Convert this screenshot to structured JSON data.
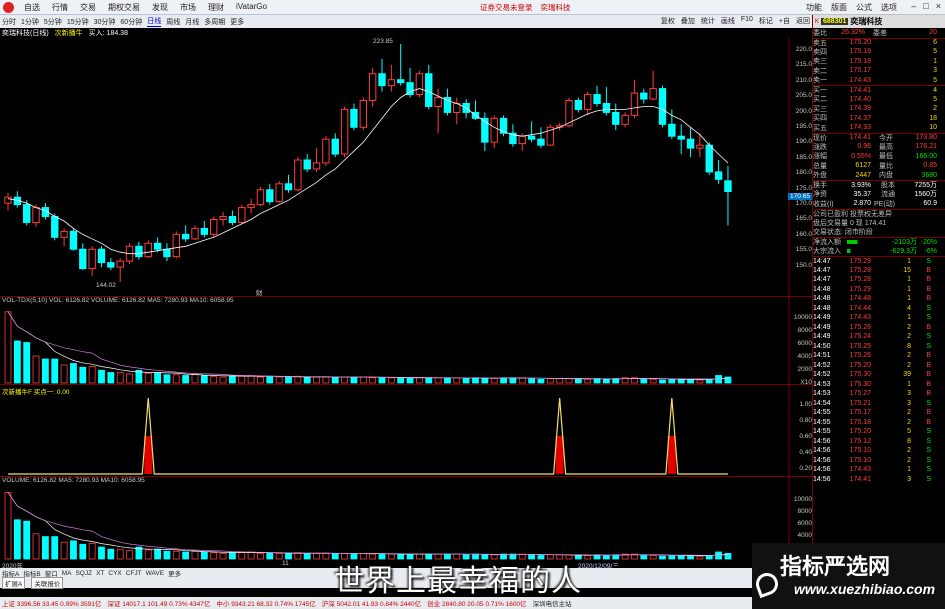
{
  "titlebar": {
    "menu": [
      "自选",
      "行情",
      "交易",
      "期权交易",
      "发现",
      "市场",
      "理财",
      "iVatarGo"
    ],
    "center": [
      "证券交易未登录",
      "奕瑞科技"
    ],
    "right": [
      "功能",
      "版面",
      "公式",
      "选项"
    ],
    "winbtns": [
      "–",
      "□",
      "×"
    ]
  },
  "periodbar": {
    "items": [
      "分时",
      "1分钟",
      "5分钟",
      "15分钟",
      "30分钟",
      "60分钟",
      "日线",
      "周线",
      "月线",
      "多周期",
      "更多"
    ],
    "selected": "日线",
    "tools": [
      "复权",
      "叠加",
      "统计",
      "画线",
      "F10",
      "标记",
      "+自",
      "返回"
    ]
  },
  "infoline": {
    "title": "奕瑞科技(日线)",
    "indicator": "次新播牛",
    "buy": "买入: 184.38"
  },
  "chart": {
    "price_axis": [
      "220.0",
      "215.0",
      "210.0",
      "205.0",
      "200.0",
      "195.0",
      "190.0",
      "185.0",
      "180.0",
      "175.0",
      "170.0",
      "165.0",
      "160.0",
      "155.0",
      "150.0"
    ],
    "current_price_tag": "170.65",
    "high_label": "223.85",
    "low_label": "144.02",
    "cai_label": "财",
    "vol_label": "VOL-TDX(5,10)  VOL: 6126.82  VOLUME: 6126.82  MA5: 7280.93  MA10: 6058.95",
    "vol_axis": [
      "10000",
      "8000",
      "6000",
      "4000",
      "2000",
      "X10"
    ],
    "ind_label": "次新播牛F  买点一: 0.00",
    "ind_axis": [
      "1.00",
      "0.80",
      "0.60",
      "0.40",
      "0.20"
    ],
    "vol2_label": "VOLUME: 6126.82  MA5: 7280.93  MA10: 6058.95",
    "vol2_axis": [
      "10000",
      "8000",
      "6000",
      "4000",
      "2000"
    ],
    "date_labels": [
      "2020年",
      "11",
      "2020/12/09/三"
    ]
  },
  "panel": {
    "code": "688301",
    "name": "奕瑞科技",
    "weibi": {
      "label": "委比",
      "val": "26.32%",
      "label2": "委差",
      "val2": "20"
    },
    "asks": [
      {
        "name": "卖五",
        "price": "175.20",
        "vol": "6"
      },
      {
        "name": "卖四",
        "price": "175.19",
        "vol": "5"
      },
      {
        "name": "卖三",
        "price": "175.18",
        "vol": "1"
      },
      {
        "name": "卖二",
        "price": "175.17",
        "vol": "3"
      },
      {
        "name": "卖一",
        "price": "174.43",
        "vol": "5"
      }
    ],
    "bids": [
      {
        "name": "买一",
        "price": "174.41",
        "vol": "4"
      },
      {
        "name": "买二",
        "price": "174.40",
        "vol": "5"
      },
      {
        "name": "买三",
        "price": "174.39",
        "vol": "2"
      },
      {
        "name": "买四",
        "price": "174.37",
        "vol": "18"
      },
      {
        "name": "买五",
        "price": "174.33",
        "vol": "10"
      }
    ],
    "stats": [
      {
        "l1": "现价",
        "v1": "174.41",
        "l2": "今开",
        "v2": "173.80"
      },
      {
        "l1": "涨跌",
        "v1": "0.96",
        "l2": "最高",
        "v2": "176.21"
      },
      {
        "l1": "涨幅",
        "v1": "0.55%",
        "l2": "最低",
        "v2": "166.00"
      },
      {
        "l1": "总量",
        "v1": "6127",
        "l2": "量比",
        "v2": "0.85"
      },
      {
        "l1": "外盘",
        "v1": "2447",
        "l2": "内盘",
        "v2": "3680"
      }
    ],
    "stats2": [
      {
        "l1": "换手",
        "v1": "3.93%",
        "l2": "股本",
        "v2": "7255万"
      },
      {
        "l1": "净资",
        "v1": "35.37",
        "l2": "流通",
        "v2": "1560万"
      },
      {
        "l1": "收益(I)",
        "v1": "2.870",
        "l2": "PE(动)",
        "v2": "60.9"
      }
    ],
    "notes": [
      "公司已盈利 投票权无差异",
      "盘后交易量 0 现 174.41",
      "交易状态: 闭市阶段"
    ],
    "flows": [
      {
        "label": "净流入额",
        "val": "-2103万",
        "pct": "-20%",
        "fill": 0.35
      },
      {
        "label": "大宗流入",
        "val": "-629.3万",
        "pct": "-6%",
        "fill": 0.12
      }
    ],
    "ticks": [
      {
        "t": "14:47",
        "p": "175.29",
        "v": "1",
        "d": "S"
      },
      {
        "t": "14:47",
        "p": "175.28",
        "v": "15",
        "d": "B"
      },
      {
        "t": "14:47",
        "p": "175.28",
        "v": "1",
        "d": "B"
      },
      {
        "t": "14:48",
        "p": "175.29",
        "v": "1",
        "d": "B"
      },
      {
        "t": "14:48",
        "p": "174.48",
        "v": "1",
        "d": "B"
      },
      {
        "t": "14:48",
        "p": "174.44",
        "v": "4",
        "d": "S"
      },
      {
        "t": "14:49",
        "p": "174.43",
        "v": "1",
        "d": "S"
      },
      {
        "t": "14:49",
        "p": "175.26",
        "v": "2",
        "d": "B"
      },
      {
        "t": "14:49",
        "p": "175.24",
        "v": "2",
        "d": "S"
      },
      {
        "t": "14:50",
        "p": "175.25",
        "v": "8",
        "d": "S"
      },
      {
        "t": "14:51",
        "p": "175.26",
        "v": "2",
        "d": "B"
      },
      {
        "t": "14:52",
        "p": "175.20",
        "v": "2",
        "d": "B"
      },
      {
        "t": "14:52",
        "p": "175.30",
        "v": "39",
        "d": "B"
      },
      {
        "t": "14:53",
        "p": "175.30",
        "v": "1",
        "d": "B"
      },
      {
        "t": "14:53",
        "p": "175.27",
        "v": "3",
        "d": "B"
      },
      {
        "t": "14:54",
        "p": "175.21",
        "v": "3",
        "d": "S"
      },
      {
        "t": "14:55",
        "p": "175.17",
        "v": "2",
        "d": "B"
      },
      {
        "t": "14:55",
        "p": "175.18",
        "v": "2",
        "d": "B"
      },
      {
        "t": "14:55",
        "p": "175.20",
        "v": "5",
        "d": "S"
      },
      {
        "t": "14:56",
        "p": "175.12",
        "v": "8",
        "d": "S"
      },
      {
        "t": "14:56",
        "p": "175.10",
        "v": "2",
        "d": "S"
      },
      {
        "t": "14:56",
        "p": "175.10",
        "v": "2",
        "d": "S"
      },
      {
        "t": "14:56",
        "p": "174.43",
        "v": "1",
        "d": "S"
      },
      {
        "t": "14:56",
        "p": "174.41",
        "v": "3",
        "d": "S"
      }
    ]
  },
  "tabbar": {
    "row1": [
      "指标A",
      "指标B",
      "窗口",
      "MA",
      "SQJZ",
      "XT",
      "CYX",
      "CFJT",
      "WAVE",
      "更多"
    ],
    "row2": [
      "扩展A",
      "关联报价"
    ]
  },
  "status": [
    "上证 3396.56  33.45  0.99%  3591亿",
    "深证 14017.1  101.49  0.73%  4347亿",
    "中小 9343.21  68.32  0.74%  1745亿",
    "沪深 5042.01  41.93  0.84%  2440亿",
    "创业 2840.80  20.05  0.71%  1600亿",
    "深圳电信主站"
  ],
  "subtitle": "世界上最幸福的人",
  "watermark": {
    "cn": "指标严选网",
    "url": "www.xuezhibiao.com"
  },
  "colors": {
    "up": "#ff3b3b",
    "down": "#00ffff",
    "ma": "#ffffff",
    "signal": "#f5e06a",
    "signal_bar": "#e00000"
  },
  "chart_data": {
    "type": "candlestick",
    "ylim": [
      146,
      224
    ],
    "candles": [
      [
        170.5,
        174,
        168,
        172.5
      ],
      [
        172.5,
        174.5,
        169,
        170
      ],
      [
        170,
        171.5,
        163,
        164
      ],
      [
        164,
        170,
        162.5,
        169
      ],
      [
        169,
        170.5,
        165,
        166
      ],
      [
        166,
        167,
        158,
        159
      ],
      [
        159,
        162,
        156,
        161
      ],
      [
        161,
        162,
        154.5,
        155
      ],
      [
        155,
        157,
        148,
        148.5
      ],
      [
        148.5,
        156,
        146,
        155
      ],
      [
        155,
        156,
        149,
        150.5
      ],
      [
        150.5,
        152,
        148,
        149
      ],
      [
        149,
        152,
        144,
        151
      ],
      [
        151,
        157,
        150,
        156
      ],
      [
        156,
        157.5,
        151.5,
        152.5
      ],
      [
        152.5,
        158,
        152,
        157
      ],
      [
        157,
        159,
        154,
        155
      ],
      [
        155,
        157,
        151,
        152.5
      ],
      [
        152.5,
        161,
        152,
        160
      ],
      [
        160,
        163,
        157.5,
        158.5
      ],
      [
        158.5,
        163,
        158,
        162
      ],
      [
        162,
        164.5,
        159,
        160
      ],
      [
        160,
        166,
        159,
        165
      ],
      [
        165,
        167.5,
        163,
        166
      ],
      [
        166,
        168,
        163,
        164
      ],
      [
        164,
        170,
        163.5,
        169
      ],
      [
        169,
        172,
        167,
        170
      ],
      [
        170,
        176,
        169.5,
        175
      ],
      [
        175,
        177,
        170,
        171
      ],
      [
        171,
        178,
        170.5,
        177
      ],
      [
        177,
        180,
        174,
        175
      ],
      [
        175,
        186,
        174.5,
        185
      ],
      [
        185,
        187,
        181,
        182
      ],
      [
        182,
        189,
        181,
        184
      ],
      [
        184,
        193,
        183,
        192
      ],
      [
        192,
        194,
        186,
        187
      ],
      [
        187,
        203,
        186,
        202
      ],
      [
        202,
        204,
        195,
        196
      ],
      [
        196,
        206,
        195,
        205
      ],
      [
        205,
        216,
        203,
        214
      ],
      [
        214,
        219,
        208,
        210
      ],
      [
        210,
        217,
        208,
        212
      ],
      [
        212,
        224,
        210,
        211
      ],
      [
        211,
        216,
        206,
        207
      ],
      [
        207,
        215,
        206,
        214
      ],
      [
        214,
        217,
        202,
        203
      ],
      [
        203,
        209,
        194,
        206
      ],
      [
        206,
        209,
        200,
        201
      ],
      [
        201,
        206,
        197,
        204
      ],
      [
        204,
        205.5,
        199,
        201
      ],
      [
        201,
        205,
        198.5,
        199
      ],
      [
        199,
        201,
        188,
        191
      ],
      [
        191,
        200,
        189,
        199
      ],
      [
        199,
        200,
        193,
        194
      ],
      [
        194,
        197,
        189.5,
        190.5
      ],
      [
        190.5,
        194,
        188,
        193
      ],
      [
        193,
        198,
        191,
        192
      ],
      [
        192,
        196,
        189,
        190
      ],
      [
        190,
        197,
        190,
        196
      ],
      [
        196,
        197.5,
        195,
        196.5
      ],
      [
        196.5,
        206,
        196,
        205
      ],
      [
        205,
        206,
        201,
        202
      ],
      [
        202,
        208,
        200,
        207
      ],
      [
        207,
        210,
        203,
        204
      ],
      [
        204,
        209.5,
        200,
        201
      ],
      [
        201,
        204,
        195,
        197
      ],
      [
        197,
        201,
        196,
        200
      ],
      [
        200,
        212,
        199,
        207.5
      ],
      [
        207.5,
        209,
        204,
        205.5
      ],
      [
        205.5,
        215,
        205,
        209
      ],
      [
        209,
        210,
        196,
        197
      ],
      [
        197,
        202,
        192,
        193
      ],
      [
        193,
        197,
        187,
        192
      ],
      [
        192,
        196,
        186,
        189
      ],
      [
        189,
        194,
        186,
        190
      ],
      [
        190,
        191,
        180,
        181
      ],
      [
        181,
        185,
        177,
        178.5
      ],
      [
        178,
        183,
        163,
        174.4
      ]
    ],
    "ma": [
      172,
      171.5,
      170.5,
      169,
      168,
      166,
      164.5,
      162,
      160,
      158.5,
      157,
      155,
      154,
      153.5,
      153.5,
      154,
      154.5,
      155,
      155.5,
      156,
      157,
      158,
      159,
      160.5,
      162,
      163.5,
      165,
      167,
      168.5,
      170,
      171.5,
      173.5,
      175.5,
      177.5,
      180,
      182,
      185,
      188,
      191,
      195,
      199,
      203,
      206,
      208,
      209,
      208,
      206.5,
      205,
      204,
      202.5,
      200,
      198,
      196,
      194.5,
      193.5,
      193,
      193.5,
      194,
      195,
      196,
      197.5,
      199,
      200.5,
      201.5,
      202,
      202,
      202,
      202.5,
      203,
      203,
      202,
      200,
      198.5,
      196,
      193.5,
      190,
      187,
      184
    ],
    "volume": [
      9.5,
      5.6,
      5.4,
      3.6,
      3.2,
      3.2,
      2.4,
      2.6,
      2.1,
      2.2,
      1.7,
      1.4,
      1.4,
      1.2,
      1.7,
      1.3,
      1.4,
      1.1,
      1.1,
      1.0,
      1.1,
      1.0,
      0.9,
      0.8,
      0.9,
      1.0,
      1.0,
      0.8,
      0.8,
      0.8,
      0.8,
      0.9,
      0.8,
      0.8,
      0.8,
      0.8,
      0.8,
      0.8,
      0.8,
      0.7,
      0.7,
      0.7,
      0.7,
      0.7,
      0.7,
      0.7,
      0.7,
      0.7,
      0.7,
      0.6,
      0.7,
      0.6,
      0.6,
      0.7,
      0.7,
      0.7,
      0.6,
      0.5,
      0.6,
      0.6,
      0.6,
      0.5,
      0.5,
      0.6,
      0.5,
      0.6,
      0.7,
      0.7,
      0.6,
      0.5,
      0.4,
      0.5,
      0.5,
      0.5,
      0.4,
      0.5,
      1.0,
      0.8
    ],
    "signals": [
      15,
      59,
      71
    ]
  }
}
